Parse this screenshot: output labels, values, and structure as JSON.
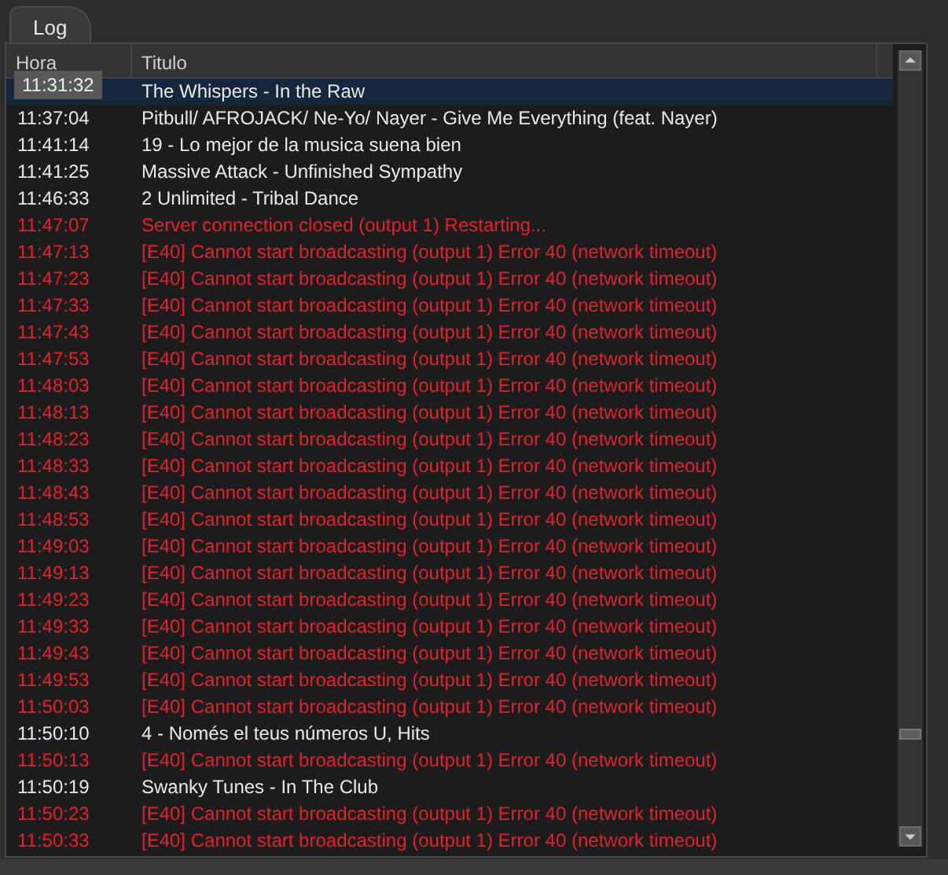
{
  "tabs": [
    {
      "label": "Log",
      "selected": true
    }
  ],
  "table": {
    "columns": [
      "Hora",
      "Titulo"
    ],
    "rows": [
      {
        "kind": "track",
        "selected": true,
        "title": "The Whispers - In the Raw"
      },
      {
        "kind": "track",
        "selected": false,
        "time": "11:37:04",
        "title": "Pitbull/ AFROJACK/ Ne-Yo/ Nayer - Give Me Everything (feat. Nayer)"
      },
      {
        "kind": "track",
        "selected": false,
        "time": "11:41:14",
        "title": "19 - Lo mejor de la musica suena bien"
      },
      {
        "kind": "track",
        "selected": false,
        "time": "11:41:25",
        "title": "Massive Attack - Unfinished Sympathy"
      },
      {
        "kind": "track",
        "selected": false,
        "time": "11:46:33",
        "title": "2 Unlimited - Tribal Dance"
      },
      {
        "kind": "error",
        "selected": false,
        "time": "11:47:07",
        "title": "Server connection closed (output 1) Restarting..."
      },
      {
        "kind": "error",
        "selected": false,
        "time": "11:47:13",
        "title": "[E40] Cannot start broadcasting (output 1) Error 40 (network timeout)"
      },
      {
        "kind": "error",
        "selected": false,
        "time": "11:47:23",
        "title": "[E40] Cannot start broadcasting (output 1) Error 40 (network timeout)"
      },
      {
        "kind": "error",
        "selected": false,
        "time": "11:47:33",
        "title": "[E40] Cannot start broadcasting (output 1) Error 40 (network timeout)"
      },
      {
        "kind": "error",
        "selected": false,
        "time": "11:47:43",
        "title": "[E40] Cannot start broadcasting (output 1) Error 40 (network timeout)"
      },
      {
        "kind": "error",
        "selected": false,
        "time": "11:47:53",
        "title": "[E40] Cannot start broadcasting (output 1) Error 40 (network timeout)"
      },
      {
        "kind": "error",
        "selected": false,
        "time": "11:48:03",
        "title": "[E40] Cannot start broadcasting (output 1) Error 40 (network timeout)"
      },
      {
        "kind": "error",
        "selected": false,
        "time": "11:48:13",
        "title": "[E40] Cannot start broadcasting (output 1) Error 40 (network timeout)"
      },
      {
        "kind": "error",
        "selected": false,
        "time": "11:48:23",
        "title": "[E40] Cannot start broadcasting (output 1) Error 40 (network timeout)"
      },
      {
        "kind": "error",
        "selected": false,
        "time": "11:48:33",
        "title": "[E40] Cannot start broadcasting (output 1) Error 40 (network timeout)"
      },
      {
        "kind": "error",
        "selected": false,
        "time": "11:48:43",
        "title": "[E40] Cannot start broadcasting (output 1) Error 40 (network timeout)"
      },
      {
        "kind": "error",
        "selected": false,
        "time": "11:48:53",
        "title": "[E40] Cannot start broadcasting (output 1) Error 40 (network timeout)"
      },
      {
        "kind": "error",
        "selected": false,
        "time": "11:49:03",
        "title": "[E40] Cannot start broadcasting (output 1) Error 40 (network timeout)"
      },
      {
        "kind": "error",
        "selected": false,
        "time": "11:49:13",
        "title": "[E40] Cannot start broadcasting (output 1) Error 40 (network timeout)"
      },
      {
        "kind": "error",
        "selected": false,
        "time": "11:49:23",
        "title": "[E40] Cannot start broadcasting (output 1) Error 40 (network timeout)"
      },
      {
        "kind": "error",
        "selected": false,
        "time": "11:49:33",
        "title": "[E40] Cannot start broadcasting (output 1) Error 40 (network timeout)"
      },
      {
        "kind": "error",
        "selected": false,
        "time": "11:49:43",
        "title": "[E40] Cannot start broadcasting (output 1) Error 40 (network timeout)"
      },
      {
        "kind": "error",
        "selected": false,
        "time": "11:49:53",
        "title": "[E40] Cannot start broadcasting (output 1) Error 40 (network timeout)"
      },
      {
        "kind": "error",
        "selected": false,
        "time": "11:50:03",
        "title": "[E40] Cannot start broadcasting (output 1) Error 40 (network timeout)"
      },
      {
        "kind": "track",
        "selected": false,
        "time": "11:50:10",
        "title": "4 - Només el teus números U, Hits"
      },
      {
        "kind": "error",
        "selected": false,
        "time": "11:50:13",
        "title": "[E40] Cannot start broadcasting (output 1) Error 40 (network timeout)"
      },
      {
        "kind": "track",
        "selected": false,
        "time": "11:50:19",
        "title": "Swanky Tunes - In The Club"
      },
      {
        "kind": "error",
        "selected": false,
        "time": "11:50:23",
        "title": "[E40] Cannot start broadcasting (output 1) Error 40 (network timeout)"
      },
      {
        "kind": "error",
        "selected": false,
        "time": "11:50:33",
        "title": "[E40] Cannot start broadcasting (output 1) Error 40 (network timeout)"
      }
    ]
  },
  "tooltip": {
    "text": "11:31:32"
  }
}
